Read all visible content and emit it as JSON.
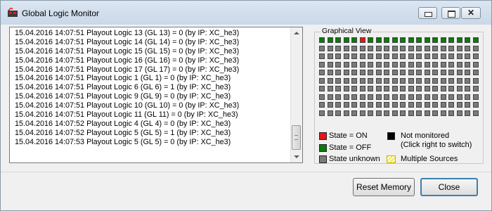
{
  "window": {
    "title": "Global Logic Monitor"
  },
  "log": {
    "lines": [
      "15.04.2016 14:07:51 Playout Logic 13 (GL 13) = 0 (by IP: XC_he3)",
      "15.04.2016 14:07:51 Playout Logic 14 (GL 14) = 0 (by IP: XC_he3)",
      "15.04.2016 14:07:51 Playout Logic 15 (GL 15) = 0 (by IP: XC_he3)",
      "15.04.2016 14:07:51 Playout Logic 16 (GL 16) = 0 (by IP: XC_he3)",
      "15.04.2016 14:07:51 Playout Logic 17 (GL 17) = 0 (by IP: XC_he3)",
      "15.04.2016 14:07:51 Playout Logic 1 (GL 1) = 0 (by IP: XC_he3)",
      "15.04.2016 14:07:51 Playout Logic 6 (GL 6) = 1 (by IP: XC_he3)",
      "15.04.2016 14:07:51 Playout Logic 9 (GL 9) = 0 (by IP: XC_he3)",
      "15.04.2016 14:07:51 Playout Logic 10 (GL 10) = 0 (by IP: XC_he3)",
      "15.04.2016 14:07:51 Playout Logic 11 (GL 11) = 0 (by IP: XC_he3)",
      "15.04.2016 14:07:52 Playout Logic 4 (GL 4) = 0 (by IP: XC_he3)",
      "15.04.2016 14:07:52 Playout Logic 5 (GL 5) = 1 (by IP: XC_he3)",
      "15.04.2016 14:07:53 Playout Logic 5 (GL 5) = 0 (by IP: XC_he3)"
    ]
  },
  "graphical_view": {
    "title": "Graphical View",
    "columns": 20,
    "rows": 10,
    "states_first_row": [
      "off",
      "off",
      "off",
      "off",
      "off",
      "on",
      "off",
      "off",
      "off",
      "off",
      "off",
      "off",
      "off",
      "off",
      "off",
      "off",
      "off",
      "off",
      "off",
      "off"
    ],
    "default_state": "unknown",
    "colors": {
      "on": "#e8141c",
      "off": "#0b7a0b",
      "unknown": "#7a7a7a",
      "not_monitored": "#000000"
    }
  },
  "legend": {
    "on": "State = ON",
    "off": "State = OFF",
    "unknown": "State unknown",
    "not_monitored": "Not monitored",
    "not_monitored_hint": "(Click right to switch)",
    "multiple": "Multiple Sources"
  },
  "buttons": {
    "reset": "Reset Memory",
    "close": "Close"
  }
}
